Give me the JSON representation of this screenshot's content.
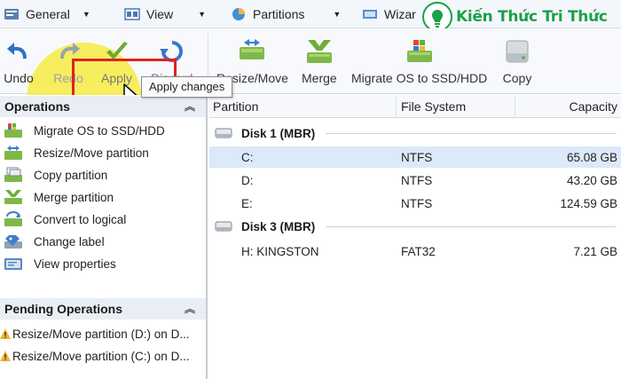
{
  "menubar": {
    "items": [
      {
        "label": "General",
        "icon": "general-icon"
      },
      {
        "label": "View",
        "icon": "view-icon"
      },
      {
        "label": "Partitions",
        "icon": "partitions-icon"
      },
      {
        "label": "Wizar",
        "icon": "wizard-icon"
      }
    ]
  },
  "watermark": {
    "text": "Kiến Thức Tri Thức",
    "icon": "brain-lightbulb-icon"
  },
  "toolbar": {
    "undo": "Undo",
    "redo": "Redo",
    "apply": "Apply",
    "discard": "Discard",
    "resize_move": "Resize/Move",
    "merge": "Merge",
    "migrate": "Migrate OS to SSD/HDD",
    "copy": "Copy",
    "tooltip": "Apply changes"
  },
  "operations": {
    "title": "Operations",
    "collapse_icon": "chevron-up-double-icon",
    "items": [
      {
        "label": "Migrate OS to SSD/HDD",
        "icon": "migrate-os-icon"
      },
      {
        "label": "Resize/Move partition",
        "icon": "resize-move-icon"
      },
      {
        "label": "Copy partition",
        "icon": "copy-partition-icon"
      },
      {
        "label": "Merge partition",
        "icon": "merge-partition-icon"
      },
      {
        "label": "Convert to logical",
        "icon": "convert-logical-icon"
      },
      {
        "label": "Change label",
        "icon": "change-label-icon"
      },
      {
        "label": "View properties",
        "icon": "view-properties-icon"
      }
    ]
  },
  "pending": {
    "title": "Pending Operations",
    "items": [
      {
        "label": "Resize/Move partition (D:) on D..."
      },
      {
        "label": "Resize/Move partition (C:) on D..."
      }
    ]
  },
  "table": {
    "headers": [
      "Partition",
      "File System",
      "Capacity"
    ],
    "disks": [
      {
        "name": "Disk 1 (MBR)",
        "partitions": [
          {
            "partition": "C:",
            "fs": "NTFS",
            "capacity": "65.08 GB",
            "selected": true
          },
          {
            "partition": "D:",
            "fs": "NTFS",
            "capacity": "43.20 GB",
            "selected": false
          },
          {
            "partition": "E:",
            "fs": "NTFS",
            "capacity": "124.59 GB",
            "selected": false
          }
        ]
      },
      {
        "name": "Disk 3 (MBR)",
        "partitions": [
          {
            "partition": "H: KINGSTON",
            "fs": "FAT32",
            "capacity": "7.21 GB",
            "selected": false
          }
        ]
      }
    ]
  },
  "colors": {
    "highlight": "#f5ec3c",
    "redbox": "#e0221e",
    "selected_row": "#dbe9f9",
    "watermark": "#1aa04a"
  }
}
